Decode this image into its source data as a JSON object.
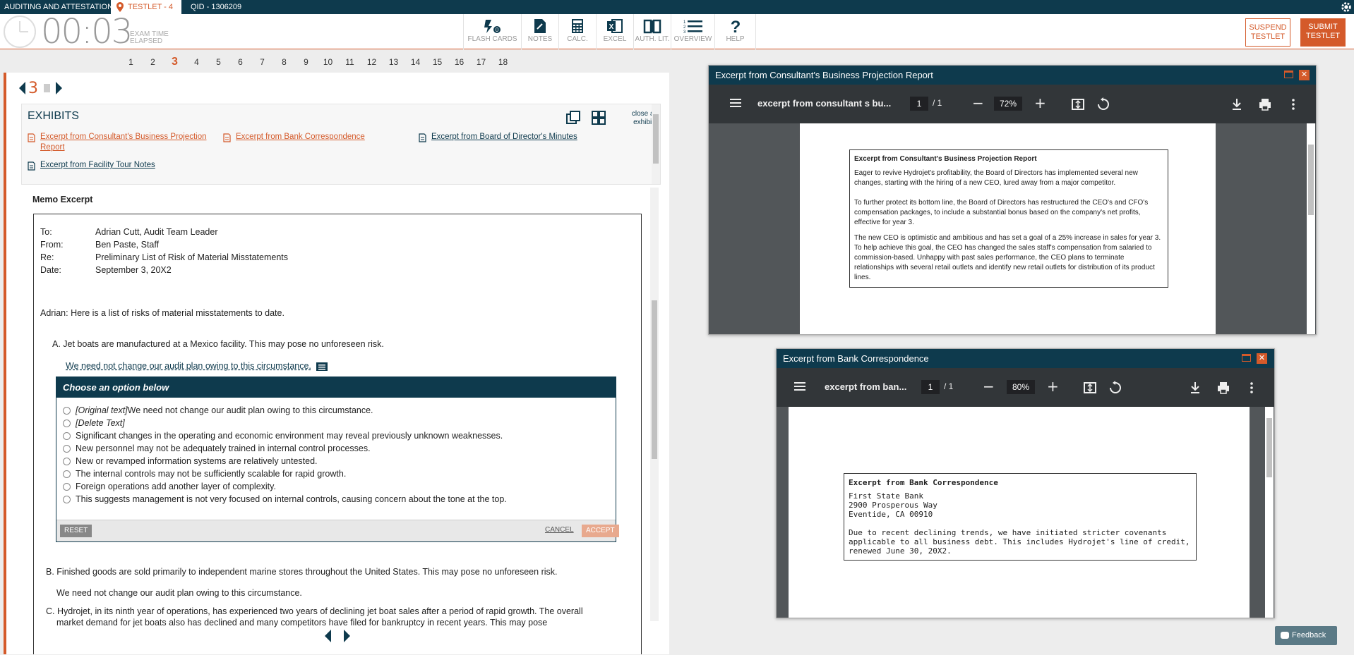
{
  "topbar": {
    "section": "AUDITING AND ATTESTATION",
    "testlet": "TESTLET - 4",
    "qid": "QID - 1306209"
  },
  "toolbar": {
    "timer": "00:03",
    "timer_label_1": "EXAM TIME",
    "timer_label_2": "ELAPSED",
    "tools": [
      "FLASH CARDS",
      "NOTES",
      "CALC.",
      "EXCEL",
      "AUTH. LIT.",
      "OVERVIEW",
      "HELP"
    ],
    "suspend_1": "SUSPEND",
    "suspend_2": "TESTLET",
    "submit_1": "SUBMIT",
    "submit_2": "TESTLET"
  },
  "question_numbers": [
    "1",
    "2",
    "3",
    "4",
    "5",
    "6",
    "7",
    "8",
    "9",
    "10",
    "11",
    "12",
    "13",
    "14",
    "15",
    "16",
    "17",
    "18"
  ],
  "current_question": "3",
  "exhibits": {
    "title": "EXHIBITS",
    "close_all_1": "close all",
    "close_all_2": "exhibits",
    "links": [
      "Excerpt from Consultant's Business Projection",
      "Report",
      "Excerpt from Bank Correspondence",
      "Excerpt from Board of Director's Minutes",
      "Excerpt from Facility Tour Notes"
    ]
  },
  "memo": {
    "title": "Memo Excerpt",
    "to_label": "To:",
    "to": "Adrian Cutt, Audit Team Leader",
    "from_label": "From:",
    "from": "Ben Paste, Staff",
    "re_label": "Re:",
    "re": "Preliminary List of Risk of Material Misstatements",
    "date_label": "Date:",
    "date": "September 3, 20X2",
    "greeting": "Adrian:  Here is a list of risks of material misstatements to date.",
    "item_a": "A. Jet boats are manufactured at a Mexico facility.  This may pose no unforeseen risk.",
    "item_a_link": "We need not change our audit plan owing to this circumstance.",
    "item_b": "B. Finished goods are sold primarily to independent marine stores throughout the United States.  This may pose no unforeseen risk.",
    "item_b_sub": "We need not change our audit plan owing to this circumstance.",
    "item_c_1": "C. Hydrojet, in its ninth year of operations, has experienced two years of declining jet boat sales after a period of rapid growth.  The overall",
    "item_c_2": "market demand for jet boats also has declined and many competitors have filed for bankruptcy in recent years.  This may pose"
  },
  "choose": {
    "header": "Choose an option below",
    "orig_tag": "[Original text]",
    "orig_text": " We need not change our audit plan owing to this circumstance.",
    "delete_tag": "[Delete Text]",
    "options": [
      "Significant changes in the operating and economic environment may reveal previously unknown weaknesses.",
      "New personnel may not be adequately trained in internal control processes.",
      "New or revamped information systems are relatively untested.",
      "The internal controls may not be sufficiently scalable for rapid growth.",
      "Foreign operations add another layer of complexity.",
      "This suggests management is not very focused on internal controls, causing concern about the tone at the top."
    ],
    "reset": "RESET",
    "cancel": "CANCEL",
    "accept": "ACCEPT"
  },
  "viewer1": {
    "title": "Excerpt from Consultant's Business Projection Report",
    "docname": "excerpt from consultant s bu...",
    "page": "1",
    "of": "/ 1",
    "zoom": "72%",
    "heading": "Excerpt from Consultant's Business Projection Report",
    "p1": "Eager to revive Hydrojet's profitability, the Board of Directors has implemented several new changes, starting with the hiring of a new CEO, lured away from a major competitor.",
    "p2": "To further protect its bottom line, the Board of Directors has restructured the CEO's and CFO's compensation packages, to include a substantial bonus based on the company's net profits, effective for year 3.",
    "p3": "The new CEO is optimistic and ambitious and has set a goal of a 25% increase in sales for year 3.  To help achieve this goal, the CEO has changed the sales staff's compensation from salaried to commission-based. Unhappy with past sales performance, the CEO plans to terminate relationships with several retail outlets and identify new retail outlets for distribution of its product lines."
  },
  "viewer2": {
    "title": "Excerpt from Bank Correspondence",
    "docname": "excerpt from ban...",
    "page": "1",
    "of": "/ 1",
    "zoom": "80%",
    "heading": "Excerpt from Bank Correspondence",
    "addr1": "First State Bank",
    "addr2": "2900 Prosperous Way",
    "addr3": "Eventide, CA 00910",
    "body": "Due to recent declining trends, we have initiated stricter covenants applicable to all business debt. This includes Hydrojet's line of credit, renewed June 30, 20X2."
  },
  "feedback": "Feedback",
  "colors": {
    "brand_dark": "#0e3a4d",
    "accent": "#d45a2a"
  }
}
